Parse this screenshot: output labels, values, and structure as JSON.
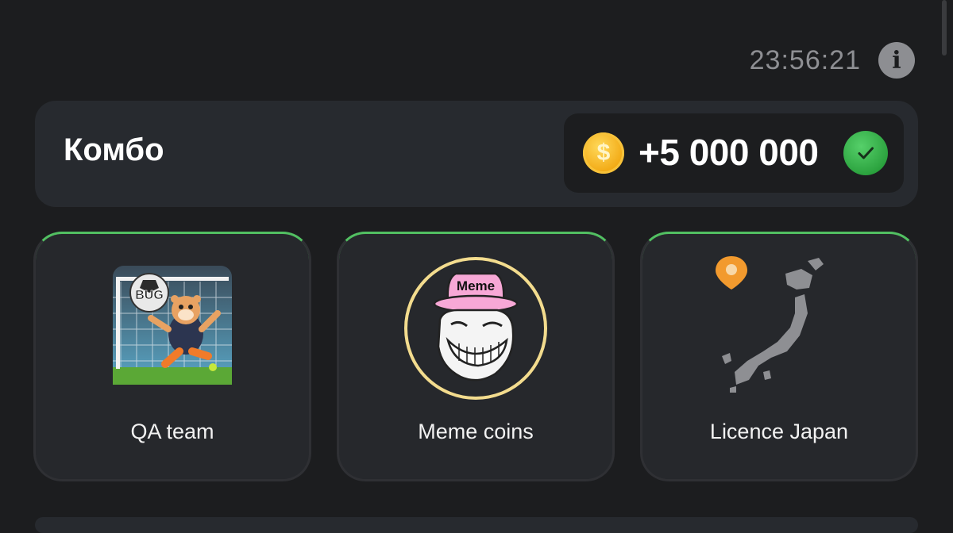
{
  "header": {
    "timer": "23:56:21",
    "info_icon": "info-icon"
  },
  "combo": {
    "title": "Комбо",
    "reward": "+5 000 000",
    "coin_icon": "coin-icon",
    "check_icon": "check-icon",
    "coin_symbol": "$"
  },
  "cards": [
    {
      "label": "QA team",
      "image": "hamster-goalkeeper-bug-image",
      "badge": "BUG"
    },
    {
      "label": "Meme coins",
      "image": "trollface-meme-hat-image",
      "badge": "Meme"
    },
    {
      "label": "Licence Japan",
      "image": "japan-map-image"
    }
  ],
  "colors": {
    "background": "#1c1d1f",
    "panel": "#272a2f",
    "accent_green": "#52c062",
    "coin_gold": "#f2a914",
    "timer_gray": "#8e8f93"
  }
}
